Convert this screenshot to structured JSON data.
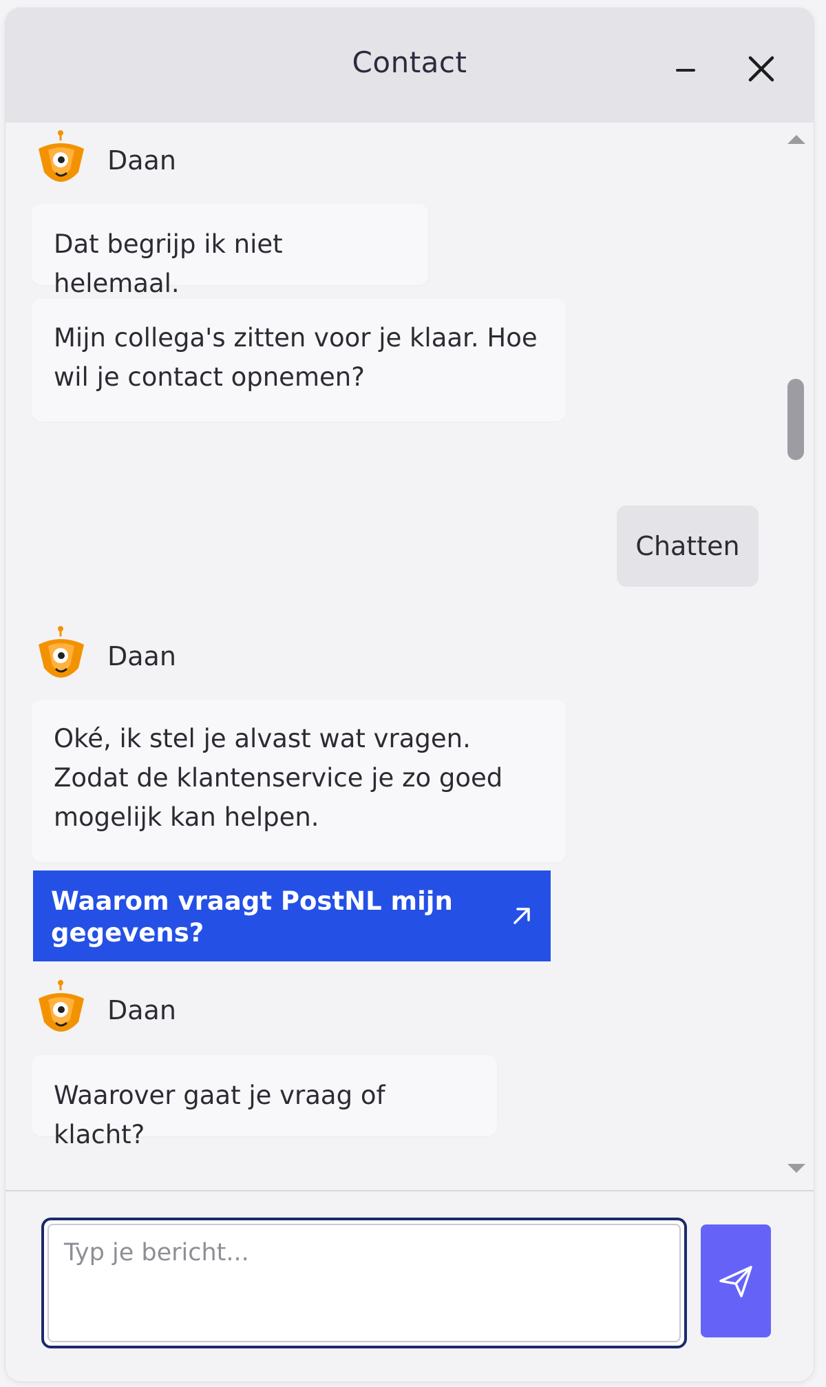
{
  "header": {
    "title": "Contact",
    "minimize_label": "Minimaliseren",
    "close_label": "Sluiten"
  },
  "messages": [
    {
      "type": "sender",
      "name": "Daan"
    },
    {
      "type": "bot",
      "text": "Dat begrijp ik niet helemaal."
    },
    {
      "type": "bot",
      "text": "Mijn collega's zitten voor je klaar. Hoe wil je contact opnemen?"
    },
    {
      "type": "user",
      "text": "Chatten"
    },
    {
      "type": "sender",
      "name": "Daan"
    },
    {
      "type": "bot",
      "text": "Oké, ik stel je alvast wat vragen. Zodat de klantenservice je zo goed mogelijk kan helpen."
    },
    {
      "type": "link",
      "text": "Waarom vraagt PostNL mijn gegevens?"
    },
    {
      "type": "sender",
      "name": "Daan"
    },
    {
      "type": "bot",
      "text": "Waarover gaat je vraag of klacht?"
    }
  ],
  "input": {
    "placeholder": "Typ je bericht..."
  },
  "colors": {
    "link_card": "#2450e6",
    "send_button": "#6563f7",
    "input_border": "#1a2a6c",
    "avatar_orange": "#f39200"
  },
  "icons": [
    "minimize-icon",
    "close-icon",
    "avatar-robot-icon",
    "external-arrow-icon",
    "send-icon"
  ]
}
